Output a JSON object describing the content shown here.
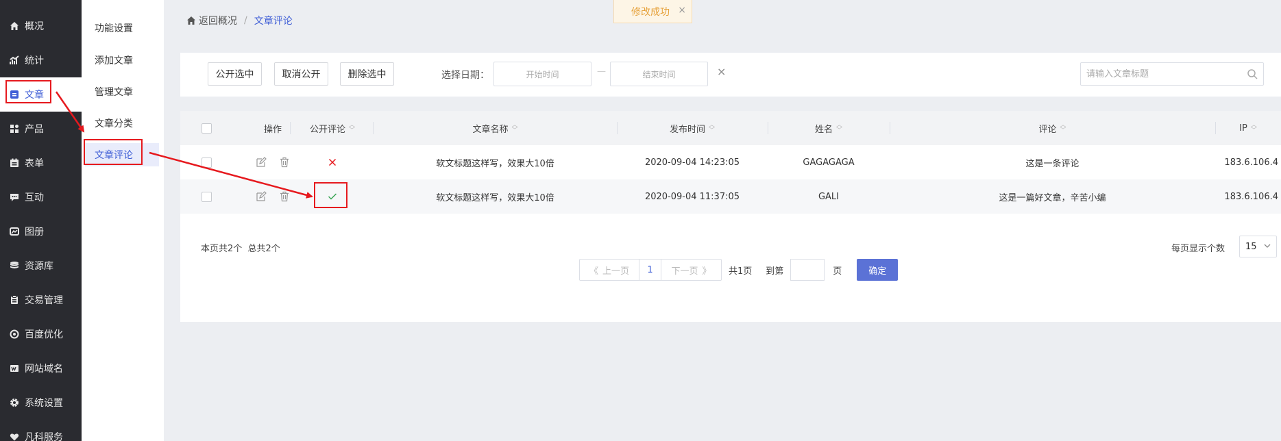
{
  "sidebar": {
    "items": [
      {
        "label": "概况",
        "icon": "home-icon"
      },
      {
        "label": "统计",
        "icon": "chart-icon"
      },
      {
        "label": "文章",
        "icon": "article-icon"
      },
      {
        "label": "产品",
        "icon": "grid-icon"
      },
      {
        "label": "表单",
        "icon": "form-icon"
      },
      {
        "label": "互动",
        "icon": "chat-icon"
      },
      {
        "label": "图册",
        "icon": "image-icon"
      },
      {
        "label": "资源库",
        "icon": "database-icon"
      },
      {
        "label": "交易管理",
        "icon": "clipboard-icon"
      },
      {
        "label": "百度优化",
        "icon": "target-icon"
      },
      {
        "label": "网站域名",
        "icon": "web-icon"
      },
      {
        "label": "系统设置",
        "icon": "gear-icon"
      },
      {
        "label": "凡科服务",
        "icon": "heart-icon"
      }
    ],
    "active_index": 2
  },
  "submenu": {
    "items": [
      "功能设置",
      "添加文章",
      "管理文章",
      "文章分类",
      "文章评论"
    ],
    "active_index": 4
  },
  "breadcrumb": {
    "back": "返回概况",
    "separator": "/",
    "current": "文章评论"
  },
  "toast": {
    "message": "修改成功",
    "close": "×"
  },
  "toolbar": {
    "publish_selected": "公开选中",
    "cancel_publish": "取消公开",
    "delete_selected": "删除选中",
    "date_label": "选择日期：",
    "start_placeholder": "开始时间",
    "end_placeholder": "结束时间",
    "dash": "—",
    "clear": "×",
    "search_placeholder": "请输入文章标题"
  },
  "table": {
    "headers": {
      "op": "操作",
      "public": "公开评论",
      "title": "文章名称",
      "time": "发布时间",
      "name": "姓名",
      "comment": "评论",
      "ip": "IP"
    },
    "rows": [
      {
        "public": false,
        "title": "软文标题这样写，效果大10倍",
        "time": "2020-09-04 14:23:05",
        "name": "GAGAGAGA",
        "comment": "这是一条评论",
        "ip": "183.6.106.4"
      },
      {
        "public": true,
        "title": "软文标题这样写，效果大10倍",
        "time": "2020-09-04 11:37:05",
        "name": "GALI",
        "comment": "这是一篇好文章，辛苦小编",
        "ip": "183.6.106.4"
      }
    ]
  },
  "pagination": {
    "page_info": "本页共2个  总共2个",
    "prev": "上一页",
    "current_page": "1",
    "next": "下一页",
    "total_pages": "共1页",
    "goto_label": "到第",
    "page_suffix": "页",
    "confirm": "确定",
    "per_page_label": "每页显示个数",
    "per_page_value": "15"
  },
  "colors": {
    "accent": "#3f5ed6",
    "annotation_red": "#e6191e",
    "sidebar_bg": "#2a2b30",
    "toast_text": "#e6a23c",
    "public_yes": "#3aa655",
    "public_no": "#e6191e"
  }
}
